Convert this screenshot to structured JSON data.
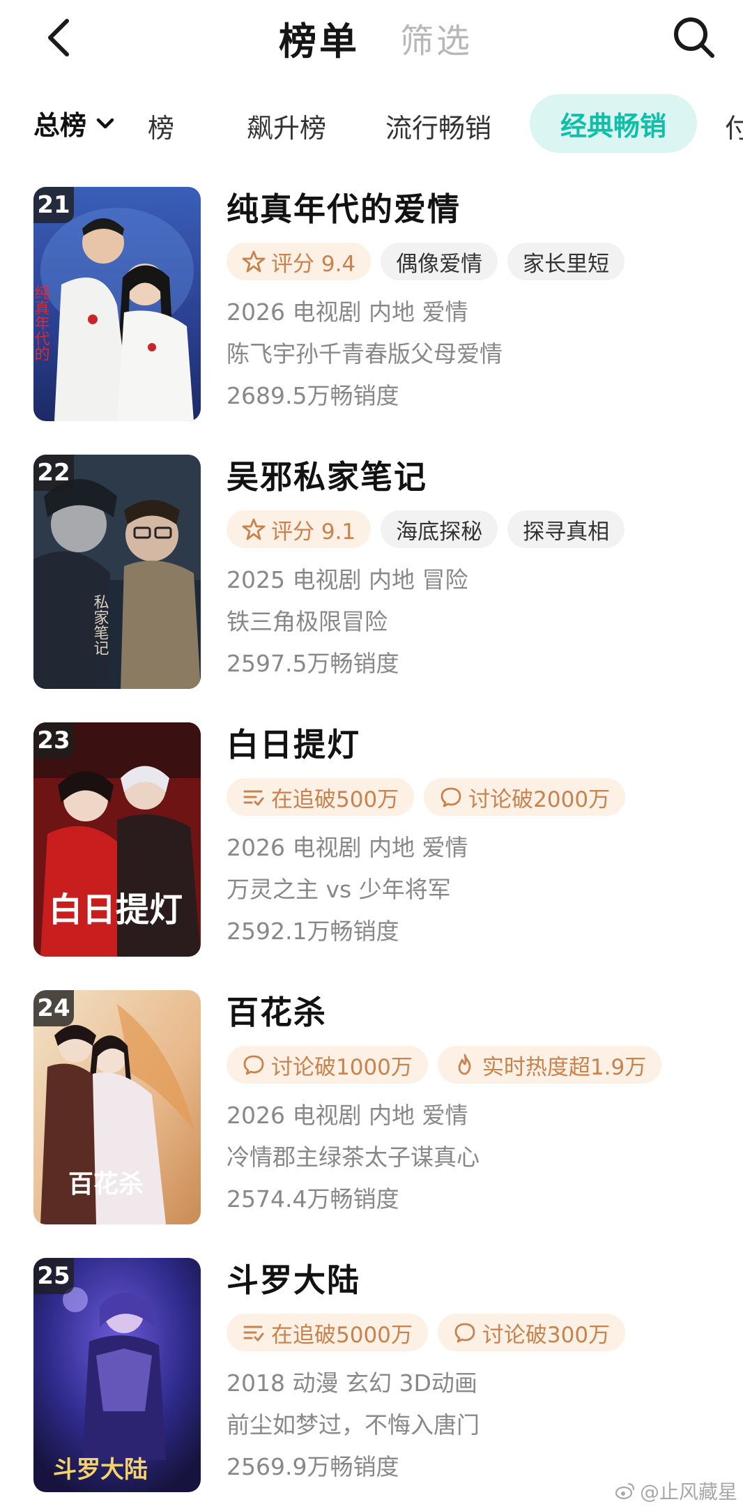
{
  "header": {
    "title": "榜单",
    "filter_label": "筛选"
  },
  "tabs": {
    "main_label": "总榜",
    "items": [
      "热播榜",
      "飙升榜",
      "流行畅销",
      "经典畅销",
      "付费榜"
    ],
    "partial_left_visible": "榜",
    "partial_right_visible": "付",
    "active": "经典畅销"
  },
  "colors": {
    "accent_teal": "#0fbfa8",
    "accent_pill_bg": "#dbf6f2",
    "tag_orange_bg": "#fdf0e4",
    "tag_orange_text": "#c8824e"
  },
  "items": [
    {
      "rank": "21",
      "title": "纯真年代的爱情",
      "tags": [
        {
          "icon": "star-icon",
          "text": "评分 9.4",
          "style": "orange"
        },
        {
          "icon": "",
          "text": "偶像爱情",
          "style": "gray"
        },
        {
          "icon": "",
          "text": "家长里短",
          "style": "gray"
        }
      ],
      "meta_line": "2026 电视剧 内地 爱情",
      "description": "陈飞宇孙千青春版父母爱情",
      "sales": "2689.5万畅销度"
    },
    {
      "rank": "22",
      "title": "吴邪私家笔记",
      "tags": [
        {
          "icon": "star-icon",
          "text": "评分 9.1",
          "style": "orange"
        },
        {
          "icon": "",
          "text": "海底探秘",
          "style": "gray"
        },
        {
          "icon": "",
          "text": "探寻真相",
          "style": "gray"
        }
      ],
      "meta_line": "2025 电视剧 内地 冒险",
      "description": "铁三角极限冒险",
      "sales": "2597.5万畅销度"
    },
    {
      "rank": "23",
      "title": "白日提灯",
      "tags": [
        {
          "icon": "list-follow-icon",
          "text": "在追破500万",
          "style": "orange"
        },
        {
          "icon": "chat-bubble-icon",
          "text": "讨论破2000万",
          "style": "orange"
        }
      ],
      "meta_line": "2026 电视剧 内地 爱情",
      "description": "万灵之主 vs 少年将军",
      "sales": "2592.1万畅销度"
    },
    {
      "rank": "24",
      "title": "百花杀",
      "tags": [
        {
          "icon": "chat-bubble-icon",
          "text": "讨论破1000万",
          "style": "orange"
        },
        {
          "icon": "flame-icon",
          "text": "实时热度超1.9万",
          "style": "orange"
        }
      ],
      "meta_line": "2026 电视剧 内地 爱情",
      "description": "冷情郡主绿茶太子谋真心",
      "sales": "2574.4万畅销度"
    },
    {
      "rank": "25",
      "title": "斗罗大陆",
      "tags": [
        {
          "icon": "list-follow-icon",
          "text": "在追破5000万",
          "style": "orange"
        },
        {
          "icon": "chat-bubble-icon",
          "text": "讨论破300万",
          "style": "orange"
        }
      ],
      "meta_line": "2018 动漫 玄幻 3D动画",
      "description": "前尘如梦过，不悔入唐门",
      "sales": "2569.9万畅销度"
    }
  ],
  "watermark": "@止风藏星"
}
